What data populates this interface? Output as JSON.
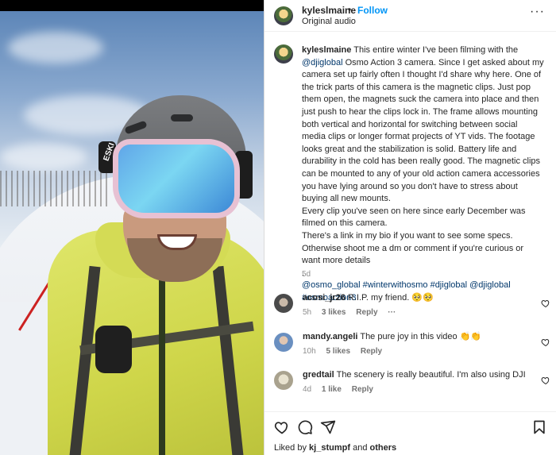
{
  "header": {
    "username": "kyleslmaine",
    "separator": "•",
    "follow_label": "Follow",
    "audio_label": "Original audio",
    "more_label": "···"
  },
  "caption": {
    "username": "kyleslmaine",
    "lines": [
      "This entire winter I've been filming with the",
      "@djiglobal Osmo Action 3 camera. Since I get asked about my",
      "camera set up fairly often I thought I'd share why here. One of",
      "the trick parts of this camera is the magnetic clips. Just pop",
      "them open, the magnets suck the camera into place and then",
      "just push to hear the clips lock in. The frame allows mounting",
      "both vertical and horizontal for switching between social",
      "media clips or longer format projects of YT vids. The footage",
      "looks great and the stabilization is solid. Battery life and",
      "durability in the cold has been really good. The magnetic clips",
      "can be mounted to any of your old action camera accessories",
      "you have lying around so you don't have to stress about",
      "buying all new mounts.",
      "Every clip you've seen on here since early December was",
      "filmed on this camera.",
      "There's a link in my bio if you want to see some specs.",
      "Otherwise shoot me a dm or comment if you're curious or",
      "want more details",
      ".",
      "@osmo_global #winterwithosmo #djiglobal @djiglobal",
      "#osmoaction3"
    ],
    "time": "5d"
  },
  "comments": [
    {
      "username": "acosi_jr26",
      "text": "R.I.P. my friend. 🥺🥺",
      "time": "5h",
      "likes": "3 likes",
      "reply": "Reply",
      "more": "···"
    },
    {
      "username": "mandy.angeli",
      "text": "The pure joy in this video 👏👏",
      "time": "10h",
      "likes": "5 likes",
      "reply": "Reply"
    },
    {
      "username": "gredtail",
      "text": "The scenery is really beautiful. I'm also using DJI",
      "time": "4d",
      "likes": "1 like",
      "reply": "Reply"
    }
  ],
  "footer": {
    "liked_prefix": "Liked by",
    "liked_user": "kj_stumpf",
    "liked_and": "and",
    "liked_others": "others"
  },
  "media": {
    "goggle_brand": "ESKI"
  },
  "colors": {
    "link": "#00376b",
    "follow": "#0095f6",
    "muted": "#8e8e8e",
    "jacket": "#d4db55"
  }
}
